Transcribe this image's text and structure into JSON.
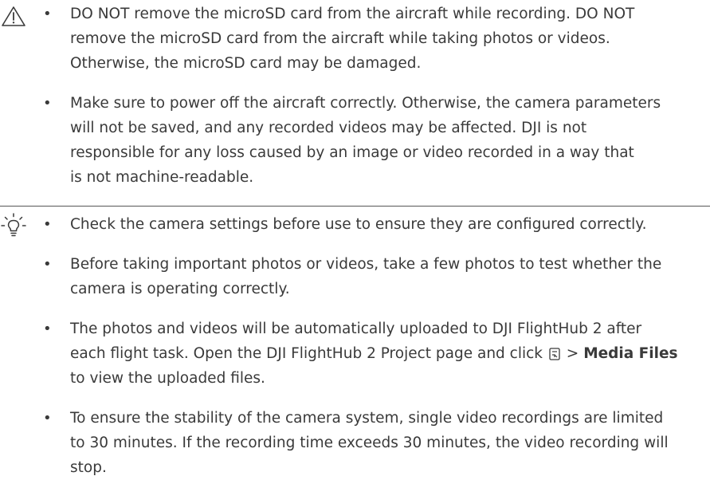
{
  "warning": {
    "icon": "warning-triangle-icon",
    "items": [
      {
        "lines": [
          "DO NOT remove the microSD card from the aircraft while recording. DO NOT",
          "remove the microSD card from the aircraft while taking photos or videos.",
          "Otherwise, the microSD card may be damaged."
        ]
      },
      {
        "lines": [
          "Make sure to power off the aircraft correctly. Otherwise, the camera parameters",
          "will not be saved, and any recorded videos may be affected. DJI is not",
          "responsible for any loss caused by an image or video recorded in a way that",
          "is not machine-readable."
        ]
      }
    ]
  },
  "tips": {
    "icon": "lightbulb-icon",
    "items": [
      {
        "lines": [
          "Check the camera settings before use to ensure they are configured correctly."
        ]
      },
      {
        "lines": [
          "Before taking important photos or videos, take a few photos to test whether the",
          "camera is operating correctly."
        ]
      },
      {
        "line1": "The photos and videos will be automatically uploaded to DJI FlightHub 2 after",
        "line2_before": "each flight task. Open the DJI FlightHub 2 Project page and click",
        "line2_icon": "media-files-icon",
        "line2_gt": ">",
        "line2_bold": "Media Files",
        "line3": "to view the uploaded files."
      },
      {
        "lines": [
          "To ensure the stability of the camera system, single video recordings are limited",
          "to 30 minutes. If the recording time exceeds 30 minutes, the video recording will",
          "stop."
        ]
      }
    ]
  },
  "bullet": "•"
}
